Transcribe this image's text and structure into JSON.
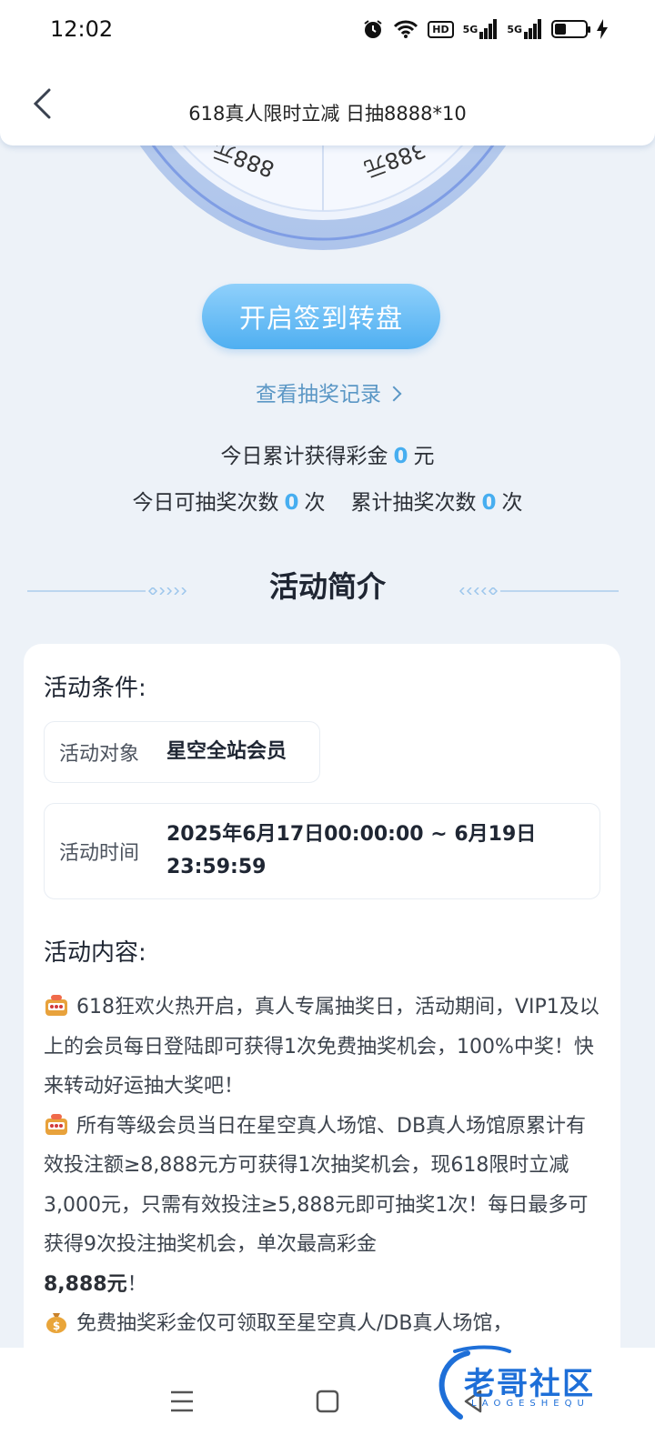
{
  "status_bar": {
    "time": "12:02",
    "hd_label": "HD",
    "signal1_label": "5G",
    "signal2_label": "5G"
  },
  "header": {
    "title": "618真人限时立减 日抽8888*10"
  },
  "wheel": {
    "label_left": "888元",
    "label_right": "388元"
  },
  "actions": {
    "spin_label": "开启签到转盘",
    "records_label": "查看抽奖记录"
  },
  "stats": {
    "today_bonus_prefix": "今日累计获得彩金",
    "today_bonus_value": "0",
    "today_bonus_unit": "元",
    "draws_available_prefix": "今日可抽奖次数",
    "draws_available_value": "0",
    "draws_available_unit": "次",
    "draws_total_prefix": "累计抽奖次数",
    "draws_total_value": "0",
    "draws_total_unit": "次"
  },
  "intro": {
    "title": "活动简介",
    "conditions_heading": "活动条件:",
    "target_label": "活动对象",
    "target_value": "星空全站会员",
    "time_label": "活动时间",
    "time_value_line1": "2025年6月17日00:00:00 ~ 6月19日",
    "time_value_line2": "23:59:59",
    "content_heading": "活动内容:",
    "p1": "618狂欢火热开启，真人专属抽奖日，活动期间，VIP1及以上的会员每日登陆即可获得1次免费抽奖机会，100%中奖！快来转动好运抽大奖吧！",
    "p2": "所有等级会员当日在星空真人场馆、DB真人场馆原累计有效投注额≥8,888元方可获得1次抽奖机会，现618限时立减3,000元，只需有效投注≥5,888元即可抽奖1次！每日最多可获得9次投注抽奖机会，单次最高彩金",
    "p2_bold": "8,888元",
    "p2_end": "！",
    "p3": "免费抽奖彩金仅可领取至星空真人/DB真人场馆，"
  },
  "watermark": {
    "text": "老哥社区",
    "sub": "LAOGESHEQU"
  },
  "colors": {
    "accent": "#47aef0",
    "link": "#5b97c5",
    "background": "#edf2f8"
  }
}
